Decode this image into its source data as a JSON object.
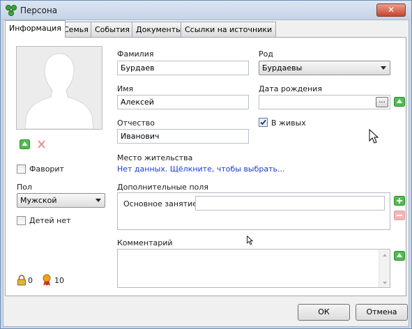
{
  "window": {
    "title": "Персона",
    "close_glyph": "✕"
  },
  "tabs": [
    "Информация",
    "Семья",
    "События",
    "Документы",
    "Ссылки на источники"
  ],
  "photo_controls": {
    "add_icon": "up-arrow-icon",
    "remove_icon": "remove-x-icon"
  },
  "left": {
    "favorite_label": "Фаворит",
    "favorite_checked": false,
    "gender_label": "Пол",
    "gender_value": "Мужской",
    "no_children_label": "Детей нет",
    "no_children_checked": false,
    "lock_count": "0",
    "award_count": "10"
  },
  "form": {
    "surname_label": "Фамилия",
    "surname_value": "Бурдаев",
    "name_label": "Имя",
    "name_value": "Алексей",
    "patronymic_label": "Отчество",
    "patronymic_value": "Иванович",
    "family_label": "Род",
    "family_value": "Бурдаевы",
    "birthdate_label": "Дата рождения",
    "birthdate_value": "",
    "birthdate_button": "...",
    "alive_label": "В живых",
    "alive_checked": true,
    "residence_label": "Место жительства",
    "residence_link": "Нет данных. Щёлкните, чтобы выбрать...",
    "extra_fields_label": "Дополнительные поля",
    "occupation_label": "Основное занятие:",
    "occupation_value": "",
    "comment_label": "Комментарий",
    "comment_value": ""
  },
  "buttons": {
    "ok": "ОК",
    "cancel": "Отмена"
  },
  "colors": {
    "link": "#1b3bd4",
    "accent_green": "#3fae3f",
    "close_red": "#c7452d"
  }
}
